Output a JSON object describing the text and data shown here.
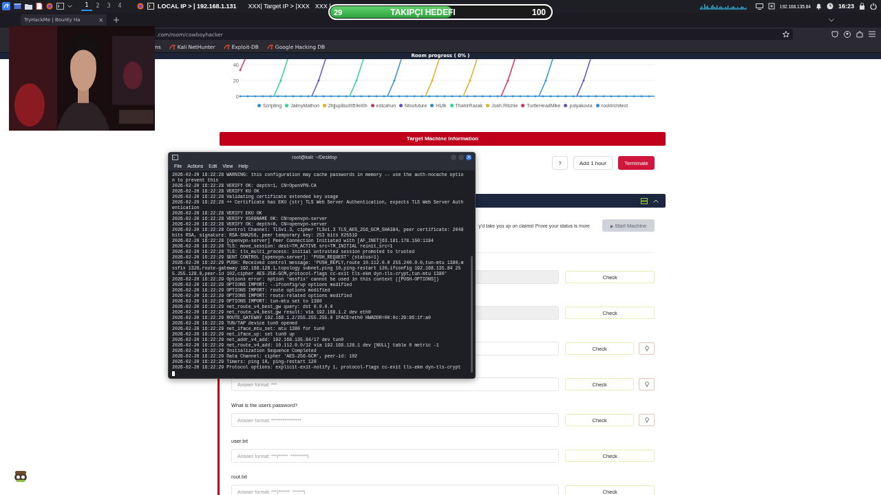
{
  "top_panel": {
    "workspaces": [
      {
        "label": "1",
        "selected": true
      },
      {
        "label": "2",
        "selected": false
      },
      {
        "label": "3",
        "selected": false
      },
      {
        "label": "4",
        "selected": false
      }
    ],
    "local_ip": "LOCAL IP > | 192.168.1.131",
    "target_ip": "XXX| Target IP > |XXX",
    "vpn_ip": "XXX |",
    "net_ip": "192.168.135.84",
    "clock": "16:23"
  },
  "follower_goal": {
    "count": "29",
    "label": "TAKIPÇI HEDEFI",
    "goal": "100",
    "level": 0.55
  },
  "browser": {
    "tab": "TryHackMe | Bounty Ha",
    "tab_close": "×",
    "url": ".com/room/cowboyhacker",
    "bookmarks": [
      "ns",
      "Kali NetHunter",
      "Exploit-DB",
      "Google Hacking DB"
    ]
  },
  "room_progress": "Room progress ( 0% )",
  "chart": {
    "yticks": [
      "40",
      "20",
      "0"
    ],
    "legend": [
      {
        "name": "Scripting",
        "color": "#2e8fd6"
      },
      {
        "name": "JaimyMathon",
        "color": "#2ed39a"
      },
      {
        "name": "2bjjup8sot959el0h",
        "color": "#e5ac1d"
      },
      {
        "name": "edicahun",
        "color": "#d8315b"
      },
      {
        "name": "Ninofuture",
        "color": "#6a4fc2"
      },
      {
        "name": "HUlk",
        "color": "#2e8fd6"
      },
      {
        "name": "ThahirRazak",
        "color": "#2ed39a"
      },
      {
        "name": "Josh.Ritchie",
        "color": "#e5ac1d"
      },
      {
        "name": "TurtleHeadMike",
        "color": "#d8315b"
      },
      {
        "name": "polyakovia",
        "color": "#6a4fc2"
      },
      {
        "name": "root4rchitect",
        "color": "#2e8fd6"
      }
    ]
  },
  "target_machine": {
    "title": "Target Machine Information",
    "buttons": [
      {
        "label": "?",
        "kind": "plain"
      },
      {
        "label": "Add 1 hour",
        "kind": "plain"
      },
      {
        "label": "Terminate",
        "kind": "danger"
      }
    ]
  },
  "task": {
    "intro": "y'd take you up on claims! Prove your status is more",
    "start_button": {
      "icon": "▶",
      "label": "Start Machine",
      "disabled": true
    },
    "questions": [
      {
        "disabled": true,
        "hint": false,
        "check": "Check"
      },
      {
        "disabled": true,
        "hint": false,
        "check": "Check"
      },
      {
        "disabled": false,
        "hint": true,
        "check": "Check"
      },
      {
        "disabled": false,
        "hint": true,
        "placeholder": "Answer format: ***",
        "check": "Check"
      },
      {
        "label": "What is the users password?",
        "disabled": false,
        "hint": true,
        "placeholder": "Answer format: ****************",
        "check": "Check"
      },
      {
        "label": "user.txt",
        "disabled": false,
        "hint": false,
        "placeholder": "Answer format: ***{*****_*********}",
        "check": "Check"
      },
      {
        "label": "root.txt",
        "disabled": false,
        "hint": false,
        "placeholder": "Answer format: ***{******_******}",
        "check": "Check"
      }
    ]
  },
  "terminal": {
    "title": "root@kali: ~/Desktop",
    "menu": [
      "File",
      "Actions",
      "Edit",
      "View",
      "Help"
    ],
    "lines": [
      "2026-02-20 16:22:28 WARNING: this configuration may cache passwords in memory -- use the auth-nocache option to prevent this",
      "2026-02-20 16:22:28 VERIFY OK: depth=1, CN=OpenVPN-CA",
      "2026-02-20 16:22:28 VERIFY KU OK",
      "2026-02-20 16:22:28 Validating certificate extended key usage",
      "2026-02-20 16:22:28 ++ Certificate has EKU (str) TLS Web Server Authentication, expects TLS Web Server Authentication",
      "2026-02-20 16:22:28 VERIFY EKU OK",
      "2026-02-20 16:22:28 VERIFY X509NAME OK: CN=openvpn-server",
      "2026-02-20 16:22:28 VERIFY OK: depth=0, CN=openvpn-server",
      "2026-02-20 16:22:28 Control Channel: TLSv1.3, cipher TLSv1.3 TLS_AES_256_GCM_SHA384, peer certificate: 2048 bits RSA, signature: RSA-SHA256, peer temporary key: 253 bits X25519",
      "2026-02-20 16:22:28 [openvpn-server] Peer Connection Initiated with [AF_INET]63.181.178.150:1194",
      "2026-02-20 16:22:28 TLS: move_session: dest=TM_ACTIVE src=TM_INITIAL reinit_src=1",
      "2026-02-20 16:22:28 TLS: tls_multi_process: initial untrusted session promoted to trusted",
      "2026-02-20 16:22:29 SENT CONTROL [openvpn-server]: 'PUSH_REQUEST' (status=1)",
      "2026-02-20 16:22:29 PUSH: Received control message: 'PUSH_REPLY,route 10.112.0.0 255.240.0.0,tun-mtu 1380,mssfix 1320,route-gateway 192.168.128.1,topology subnet,ping 10,ping-restart 120,ifconfig 192.168.135.84 255.255.128.0,peer-id 102,cipher AES-256-GCM,protocol-flags cc-exit tls-ekm dyn-tls-crypt,tun-mtu 1380'",
      "2026-02-20 16:22:29 Options error: option 'mssfix' cannot be used in this context ([PUSH-OPTIONS])",
      "2026-02-20 16:22:29 OPTIONS IMPORT: --ifconfig/up options modified",
      "2026-02-20 16:22:29 OPTIONS IMPORT: route options modified",
      "2026-02-20 16:22:29 OPTIONS IMPORT: route-related options modified",
      "2026-02-20 16:22:29 OPTIONS IMPORT: tun-mtu set to 1380",
      "2026-02-20 16:22:29 net_route_v4_best_gw query: dst 0.0.0.0",
      "2026-02-20 16:22:29 net_route_v4_best_gw result: via 192.168.1.2 dev eth0",
      "2026-02-20 16:22:29 ROUTE_GATEWAY 192.168.1.2/255.255.255.0 IFACE=eth0 HWADDR=00:0c:29:86:1f:a0",
      "2026-02-20 16:22:29 TUN/TAP device tun0 opened",
      "2026-02-20 16:22:29 net_iface_mtu_set: mtu 1380 for tun0",
      "2026-02-20 16:22:29 net_iface_up: set tun0 up",
      "2026-02-20 16:22:29 net_addr_v4_add: 192.168.135.84/17 dev tun0",
      "2026-02-20 16:22:29 net_route_v4_add: 10.112.0.0/12 via 192.168.128.1 dev [NULL] table 0 metric -1",
      "2026-02-20 16:22:29 Initialization Sequence Completed",
      "2026-02-20 16:22:29 Data Channel: cipher 'AES-256-GCM', peer-id: 102",
      "2026-02-20 16:22:29 Timers: ping 10, ping-restart 120",
      "2026-02-20 16:22:29 Protocol options: explicit-exit-notify 1, protocol-flags cc-exit tls-ekm dyn-tls-crypt"
    ]
  }
}
